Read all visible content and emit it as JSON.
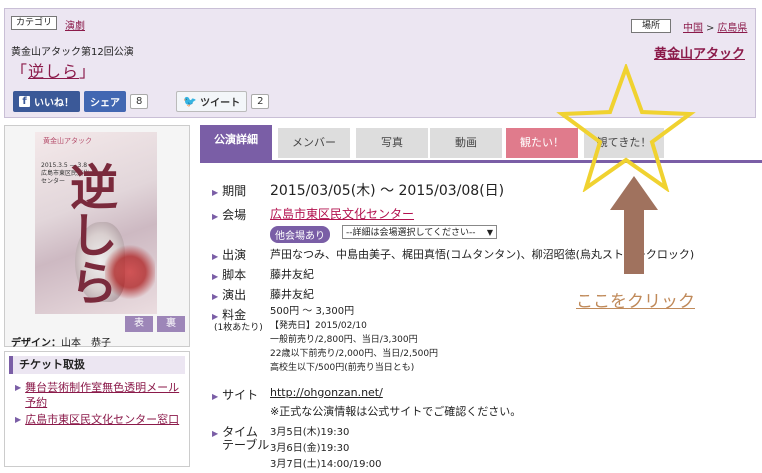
{
  "header": {
    "category_label": "カテゴリ",
    "category_value": "演劇",
    "place_label": "場所",
    "breadcrumb": [
      "中国",
      ">",
      "広島県"
    ],
    "subtitle": "黄金山アタック第12回公演",
    "title_open": "「",
    "title_link": "逆しら",
    "title_close": "」",
    "company": "黄金山アタック",
    "like_label": "いいね！",
    "share_label": "シェア",
    "share_count": "8",
    "tweet_label": "ツイート",
    "tweet_count": "2"
  },
  "sidebar": {
    "poster": {
      "top_text": "黄金山アタック",
      "vertical_title": "逆しら",
      "small_text": "2015.3.5 — 3.8 広島市東区民文化センター"
    },
    "front_label": "表",
    "back_label": "裏",
    "design_label": "デザイン：",
    "design_name": "山本　恭子",
    "ticket_heading": "チケット取扱",
    "ticket_items": [
      "舞台芸術制作室無色透明メール予約",
      "広島市東区民文化センター窓口"
    ]
  },
  "tabs": [
    {
      "label": "公演詳細"
    },
    {
      "label": "メンバー"
    },
    {
      "label": "写真"
    },
    {
      "label": "動画"
    },
    {
      "label": "観たい！"
    },
    {
      "label": "観てきた！"
    }
  ],
  "details": {
    "period_label": "期間",
    "period_value": "2015/03/05(木) ～ 2015/03/08(日)",
    "venue_label": "会場",
    "venue_value": "広島市東区民文化センター",
    "other_venue_badge": "他会場あり",
    "venue_select": "--詳細は会場選択してください--",
    "cast_label": "出演",
    "cast_value": "芦田なつみ、中島由美子、梶田真悟(コムタンタン)、柳沼昭徳(烏丸ストロークロック)",
    "script_label": "脚本",
    "script_value": "藤井友紀",
    "director_label": "演出",
    "director_value": "藤井友紀",
    "price_label": "料金",
    "price_note": "(1枚あたり)",
    "price_range": "500円 ～ 3,300円",
    "price_lines": [
      "【発売日】2015/02/10",
      "一般前売り/2,800円、当日/3,300円",
      "22歳以下前売り/2,000円、当日/2,500円",
      "高校生以下/500円(前売り当日とも)"
    ],
    "site_label": "サイト",
    "site_value": "http://ohgonzan.net/",
    "site_note": "※正式な公演情報は公式サイトでご確認ください。",
    "timetable_label": "タイム",
    "timetable_label2": "テーブル",
    "timetable": [
      "3月5日(木)19:30",
      "3月6日(金)19:30",
      "3月7日(土)14:00/19:00"
    ]
  },
  "annotation": {
    "click_here": "ここをクリック",
    "star_color": "#f0d230",
    "arrow_color": "#a0725e"
  }
}
